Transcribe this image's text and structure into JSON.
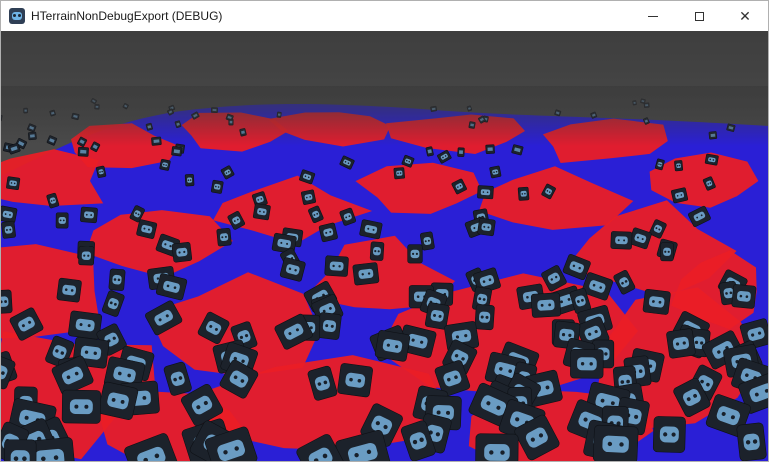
{
  "window": {
    "title": "HTerrainNonDebugExport (DEBUG)",
    "icon": "godot-icon"
  },
  "controls": {
    "minimize_icon": "minimize-icon",
    "maximize_icon": "maximize-icon",
    "close_icon": "close-icon",
    "close_glyph": "✕"
  },
  "scene": {
    "colors": {
      "sky": "#4a4a4a",
      "terrain_blue": "#2a1fd6",
      "terrain_red": "#ea1e26",
      "sprite_frame": "#1c222b",
      "sprite_face": "#6a9cc3"
    }
  }
}
